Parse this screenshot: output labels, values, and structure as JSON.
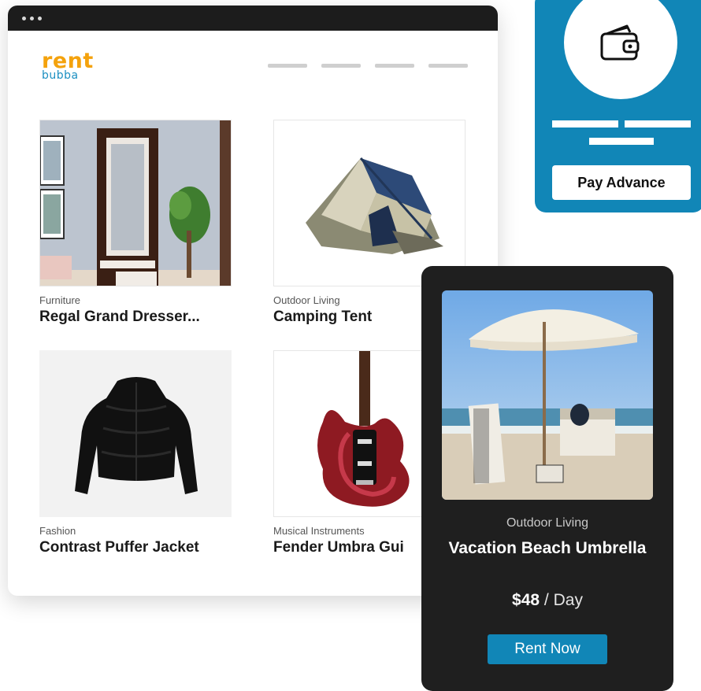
{
  "brand": {
    "logo_top": "rent",
    "logo_bottom": "bubba"
  },
  "products": [
    {
      "category": "Furniture",
      "name": "Regal Grand Dresser..."
    },
    {
      "category": "Outdoor Living",
      "name": "Camping Tent"
    },
    {
      "category": "Fashion",
      "name": "Contrast Puffer Jacket"
    },
    {
      "category": "Musical Instruments",
      "name": "Fender Umbra Gui"
    }
  ],
  "pay_panel": {
    "button_label": "Pay Advance",
    "icon": "wallet-icon"
  },
  "detail": {
    "category": "Outdoor Living",
    "name": "Vacation Beach Umbrella",
    "price": "$48",
    "price_unit": " / Day",
    "button_label": "Rent Now"
  },
  "colors": {
    "accent": "#1186b7",
    "brand_orange": "#f4a20c",
    "dark_card": "#1f1f1f"
  }
}
